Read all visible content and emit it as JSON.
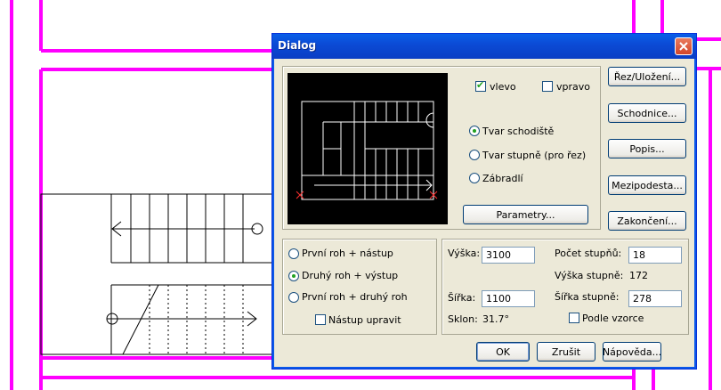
{
  "dialog": {
    "title": "Dialog",
    "preview_name": "stair-preview"
  },
  "side": {
    "left_label": "vlevo",
    "left_checked": true,
    "right_label": "vpravo",
    "right_checked": false
  },
  "mode": {
    "options": [
      "Tvar schodiště",
      "Tvar stupně (pro řez)",
      "Zábradlí"
    ],
    "selected": 0
  },
  "buttons": {
    "cut_storage": "Řez/Uložení...",
    "stringers": "Schodnice...",
    "description": "Popis...",
    "landing": "Mezipodesta...",
    "ending": "Zakončení...",
    "parameters": "Parametry...",
    "ok": "OK",
    "cancel": "Zrušit",
    "help": "Nápověda..."
  },
  "corners": {
    "options": [
      "První roh + nástup",
      "Druhý roh + výstup",
      "První roh + druhý roh"
    ],
    "selected": 1,
    "adjust_label": "Nástup upravit",
    "adjust_checked": false
  },
  "dims": {
    "height_label": "Výška:",
    "height_value": "3100",
    "width_label": "Šířka:",
    "width_value": "1100",
    "slope_label": "Sklon:",
    "slope_value": "31.7°",
    "steps_count_label": "Počet stupňů:",
    "steps_count_value": "18",
    "step_height_label": "Výška stupně:",
    "step_height_value": "172",
    "step_width_label": "Šířka stupně:",
    "step_width_value": "278",
    "formula_label": "Podle vzorce",
    "formula_checked": false
  },
  "colors": {
    "cad_lines": "#ff00ff",
    "drawing": "#000000",
    "dialog_bg": "#ece9d8"
  }
}
